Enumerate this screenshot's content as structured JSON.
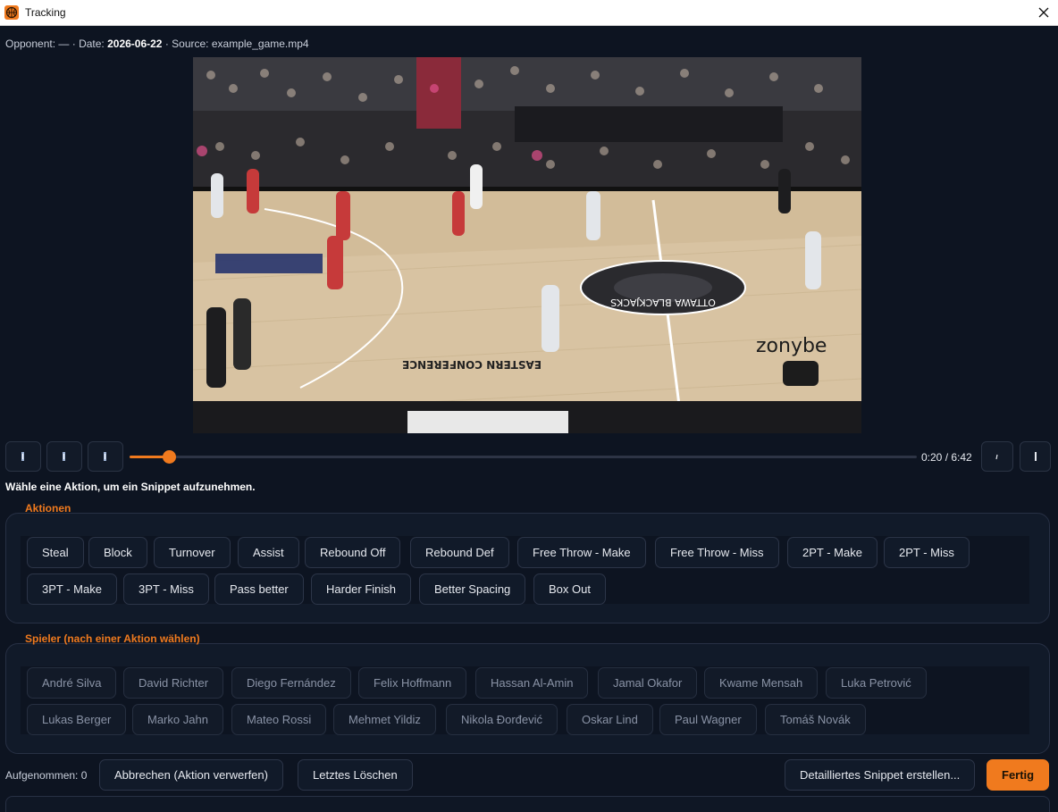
{
  "window": {
    "title": "Tracking",
    "close_icon": "close-icon"
  },
  "meta": {
    "opponent_label": "Opponent:",
    "opponent_value": "—",
    "date_label": "· Date:",
    "date_value": "2026-06-22",
    "source_label": "· Source:",
    "source_value": "example_game.mp4"
  },
  "video": {
    "description_icon": "video-frame",
    "court_text_1": "OTTAWA BLACKJACKS",
    "court_text_2": "EASTERN CONFERENCE"
  },
  "player": {
    "time_current": "0:20",
    "time_total": "6:42",
    "time_display": "0:20 / 6:42",
    "progress_fraction": 0.05,
    "controls": [
      "rewind-icon",
      "play-pause-icon",
      "forward-icon"
    ],
    "right_controls": [
      "speed-icon",
      "mark-icon"
    ]
  },
  "hint": "Wähle eine Aktion, um ein Snippet aufzunehmen.",
  "actions": {
    "title": "Aktionen",
    "items": [
      "Steal",
      "Block",
      "Turnover",
      "Assist",
      "Rebound Off",
      "Rebound Def",
      "Free Throw - Make",
      "Free Throw - Miss",
      "2PT - Make",
      "2PT - Miss",
      "3PT - Make",
      "3PT - Miss",
      "Pass better",
      "Harder Finish",
      "Better Spacing",
      "Box Out"
    ]
  },
  "players": {
    "title": "Spieler (nach einer Aktion wählen)",
    "items": [
      "André Silva",
      "David Richter",
      "Diego Fernández",
      "Felix Hoffmann",
      "Hassan Al-Amin",
      "Jamal Okafor",
      "Kwame Mensah",
      "Luka Petrović",
      "Lukas Berger",
      "Marko Jahn",
      "Mateo Rossi",
      "Mehmet Yildiz",
      "Nikola Đorđević",
      "Oskar Lind",
      "Paul Wagner",
      "Tomáš Novák"
    ]
  },
  "footer": {
    "recorded_label": "Aufgenommen: 0",
    "cancel_button": "Abbrechen (Aktion verwerfen)",
    "delete_last_button": "Letztes Löschen",
    "detailed_button": "Detailliertes Snippet erstellen...",
    "done_button": "Fertig"
  },
  "colors": {
    "accent": "#f07a1e",
    "background": "#0d1421",
    "panel": "#111a29"
  }
}
